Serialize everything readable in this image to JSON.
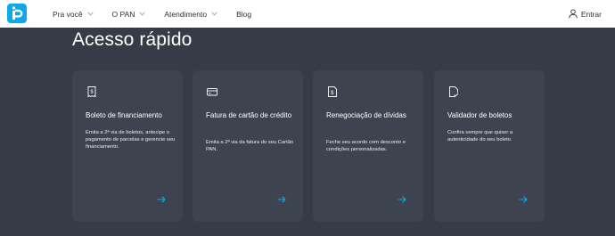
{
  "header": {
    "logo_icon": "pan-logo-icon",
    "nav": [
      {
        "label": "Pra você",
        "has_dropdown": true
      },
      {
        "label": "O PAN",
        "has_dropdown": true
      },
      {
        "label": "Atendimento",
        "has_dropdown": true
      },
      {
        "label": "Blog",
        "has_dropdown": false
      }
    ],
    "login_label": "Entrar",
    "login_icon": "user-icon"
  },
  "section": {
    "title": "Acesso rápido"
  },
  "cards": [
    {
      "icon": "receipt-icon",
      "title": "Boleto de financiamento",
      "description": "Emita a 2ª via de boletos, antecipe o pagamento de parcelas e gerencie seu financiamento."
    },
    {
      "icon": "credit-card-icon",
      "title": "Fatura de cartão de crédito",
      "description": "Emita a 2ª via da fatura do seu Cartão PAN."
    },
    {
      "icon": "document-dollar-icon",
      "title": "Renegociação de dívidas",
      "description": "Feche seu acordo com desconto e condições personalizadas."
    },
    {
      "icon": "document-check-icon",
      "title": "Validador de boletos",
      "description": "Confira sempre que quiser a autenticidade do seu boleto."
    }
  ],
  "colors": {
    "accent": "#0fa9e8",
    "background": "#353c47",
    "card": "#3d4450",
    "header": "#ffffff"
  }
}
